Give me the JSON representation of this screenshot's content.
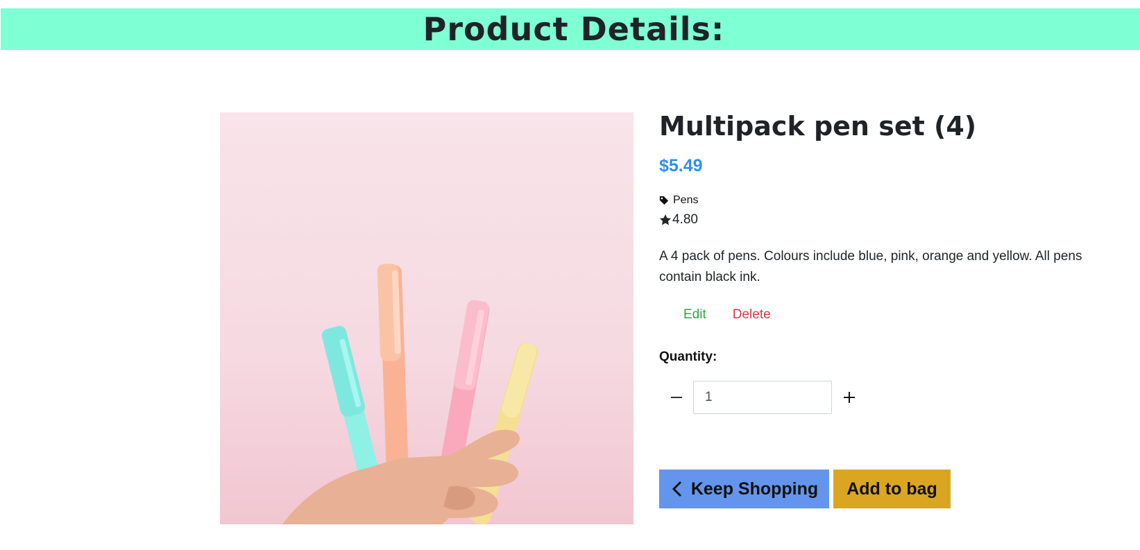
{
  "header": {
    "title": "Product Details:"
  },
  "product": {
    "name": "Multipack pen set (4)",
    "price": "$5.49",
    "category": "Pens",
    "rating": "4.80",
    "description": "A 4 pack of pens. Colours include blue, pink, orange and yellow. All pens contain black ink.",
    "image_alt": "Hand holding four pastel pens"
  },
  "admin": {
    "edit_label": "Edit",
    "delete_label": "Delete"
  },
  "quantity": {
    "label": "Quantity:",
    "value": "1"
  },
  "buttons": {
    "keep_shopping": "Keep Shopping",
    "add_to_bag": "Add to bag"
  },
  "colors": {
    "banner": "#7fffd4",
    "price": "#2e8ff0",
    "edit": "#28a745",
    "delete": "#dc3545",
    "keep_shopping_bg": "#6495ed",
    "add_to_bag_bg": "#daa520"
  },
  "icons": {
    "category": "tag-icon",
    "rating": "star-icon",
    "decrement": "minus-icon",
    "increment": "plus-icon",
    "back": "chevron-left-icon"
  }
}
